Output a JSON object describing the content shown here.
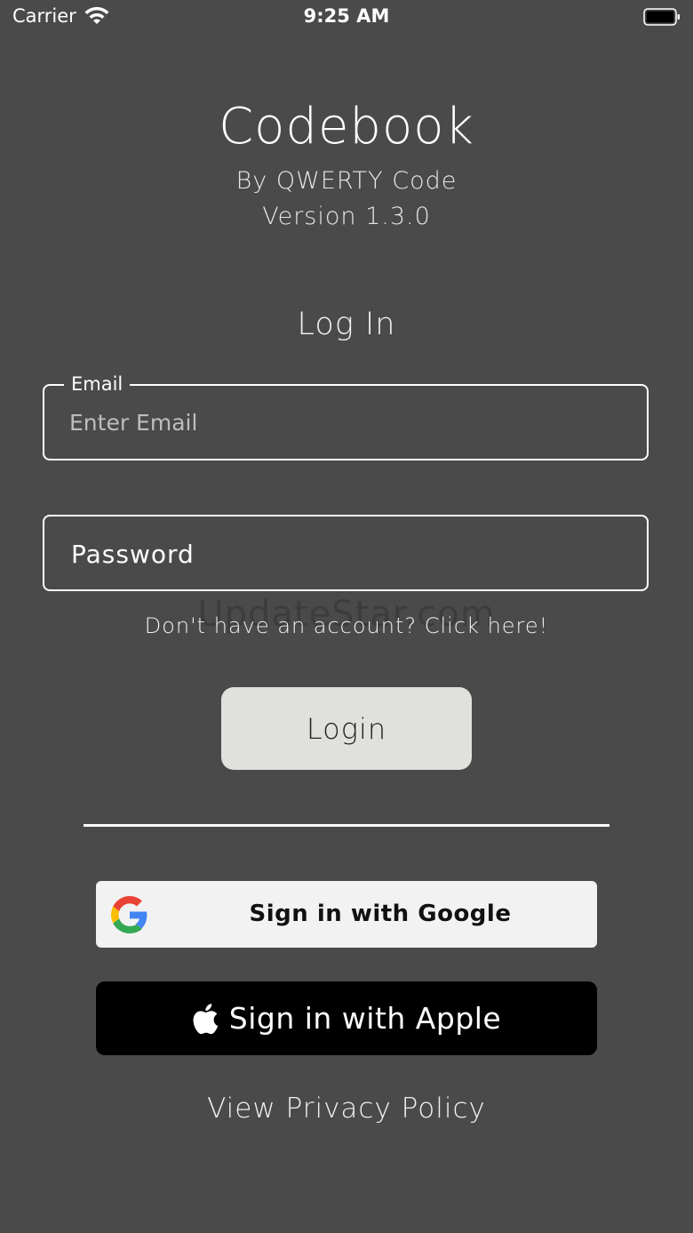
{
  "status_bar": {
    "carrier": "Carrier",
    "time": "9:25 AM"
  },
  "header": {
    "title": "Codebook",
    "byline": "By QWERTY Code",
    "version": "Version 1.3.0"
  },
  "login": {
    "heading": "Log In",
    "email": {
      "label": "Email",
      "placeholder": "Enter Email",
      "value": ""
    },
    "password": {
      "placeholder": "Password"
    },
    "signup_link": "Don't have an account? Click here!",
    "submit_label": "Login"
  },
  "watermark": "UpdateStar.com",
  "social": {
    "google_label": "Sign in with Google",
    "apple_label": "Sign in with Apple"
  },
  "footer": {
    "privacy_link": "View Privacy Policy"
  },
  "icons": {
    "wifi": "wifi-icon",
    "battery": "battery-icon",
    "google": "google-g-icon",
    "apple": "apple-logo-icon"
  },
  "colors": {
    "background": "#4a4a4a",
    "login_button": "#e0e0dc",
    "google_button": "#f2f2f2",
    "apple_button": "#000000",
    "google_blue": "#4285F4",
    "google_red": "#EA4335",
    "google_yellow": "#FBBC05",
    "google_green": "#34A853"
  }
}
